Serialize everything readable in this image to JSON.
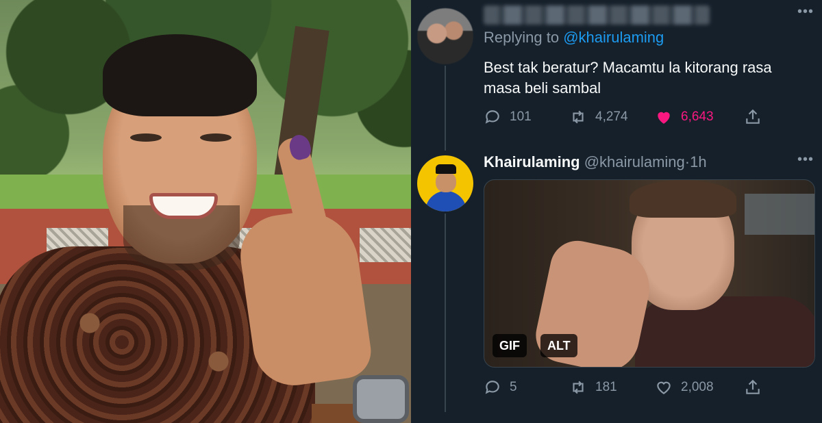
{
  "colors": {
    "background": "#15202b",
    "text_primary": "#f7f9f9",
    "text_secondary": "#8b98a5",
    "link": "#1d9bf0",
    "like_active": "#f91880",
    "divider": "#38444d"
  },
  "reply_tweet": {
    "replying_prefix": "Replying to",
    "replying_handle": "@khairulaming",
    "text_line1": "Best tak beratur? Macamtu la kitorang rasa",
    "text_line2": "masa beli sambal",
    "reply_count": "101",
    "retweet_count": "4,274",
    "like_count": "6,643",
    "liked": true
  },
  "main_tweet": {
    "display_name": "Khairulaming",
    "handle": "@khairulaming",
    "separator": "·",
    "time": "1h",
    "media_badges": [
      "GIF",
      "ALT"
    ],
    "reply_count": "5",
    "retweet_count": "181",
    "like_count": "2,008",
    "liked": false
  },
  "icons": {
    "reply": "reply-icon",
    "retweet": "retweet-icon",
    "like": "heart-icon",
    "share": "share-icon",
    "more": "more-icon"
  }
}
